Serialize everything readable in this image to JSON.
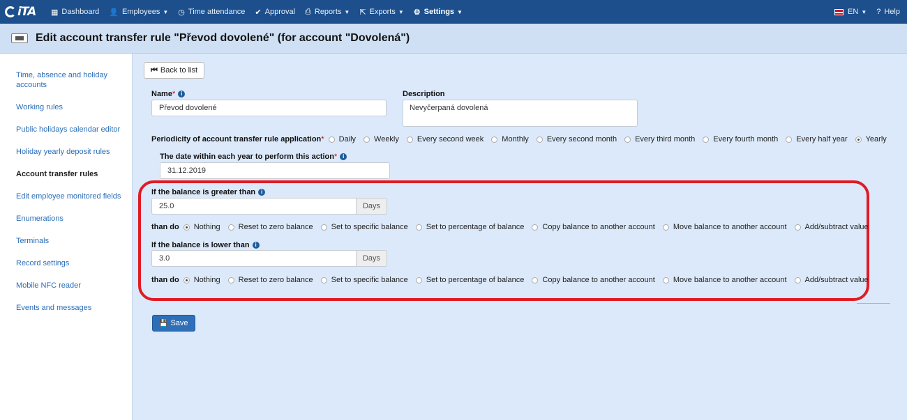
{
  "nav": {
    "logo_prefix": "C",
    "logo_suffix": "iTA",
    "items": [
      {
        "label": "Dashboard",
        "icon": "dashboard-icon",
        "glyph": "▦"
      },
      {
        "label": "Employees",
        "icon": "user-icon",
        "glyph": "👤",
        "caret": true
      },
      {
        "label": "Time attendance",
        "icon": "clock-icon",
        "glyph": "◷"
      },
      {
        "label": "Approval",
        "icon": "check-icon",
        "glyph": "✔"
      },
      {
        "label": "Reports",
        "icon": "print-icon",
        "glyph": "⎙",
        "caret": true
      },
      {
        "label": "Exports",
        "icon": "export-icon",
        "glyph": "⇱",
        "caret": true
      },
      {
        "label": "Settings",
        "icon": "gear-icon",
        "glyph": "⚙",
        "caret": true,
        "active": true
      }
    ],
    "language": "EN",
    "help": "Help"
  },
  "header": {
    "title": "Edit account transfer rule \"Převod dovolené\" (for account \"Dovolená\")"
  },
  "sidebar": {
    "items": [
      {
        "label": "Time, absence and holiday accounts",
        "current": false
      },
      {
        "label": "Working rules",
        "current": false
      },
      {
        "label": "Public holidays calendar editor",
        "current": false
      },
      {
        "label": "Holiday yearly deposit rules",
        "current": false
      },
      {
        "label": "Account transfer rules",
        "current": true
      },
      {
        "label": "Edit employee monitored fields",
        "current": false
      },
      {
        "label": "Enumerations",
        "current": false
      },
      {
        "label": "Terminals",
        "current": false
      },
      {
        "label": "Record settings",
        "current": false
      },
      {
        "label": "Mobile NFC reader",
        "current": false
      },
      {
        "label": "Events and messages",
        "current": false
      }
    ]
  },
  "form": {
    "back_label": "Back to list",
    "name_label": "Name",
    "name_value": "Převod dovolené",
    "description_label": "Description",
    "description_value": "Nevyčerpaná dovolená",
    "periodicity_label": "Periodicity of account transfer rule application",
    "periodicity_options": [
      "Daily",
      "Weekly",
      "Every second week",
      "Monthly",
      "Every second month",
      "Every third month",
      "Every fourth month",
      "Every half year",
      "Yearly"
    ],
    "periodicity_selected": "Yearly",
    "date_label": "The date within each year to perform this action",
    "date_value": "31.12.2019",
    "greater_label": "If the balance is greater than",
    "greater_value": "25.0",
    "greater_unit": "Days",
    "lower_label": "If the balance is lower than",
    "lower_value": "3.0",
    "lower_unit": "Days",
    "then_do_label": "than do",
    "action_options": [
      "Nothing",
      "Reset to zero balance",
      "Set to specific balance",
      "Set to percentage of balance",
      "Copy balance to another account",
      "Move balance to another account",
      "Add/subtract value"
    ],
    "greater_action_selected": "Nothing",
    "lower_action_selected": "Nothing",
    "save_label": "Save"
  },
  "colors": {
    "nav_bg": "#1c4f8c",
    "header_bg": "#cfe0f5",
    "main_bg": "#dce9fa",
    "highlight": "#e01b24",
    "save_bg": "#2f6fb7"
  }
}
